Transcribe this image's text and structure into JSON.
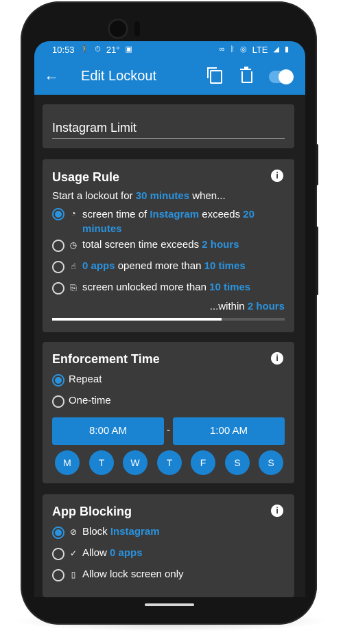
{
  "status": {
    "time": "10:53",
    "temp": "21°",
    "network": "LTE"
  },
  "appbar": {
    "back": "←",
    "title": "Edit Lockout"
  },
  "name_field": {
    "value": "Instagram Limit"
  },
  "usage_rule": {
    "title": "Usage Rule",
    "intro_prefix": "Start a lockout for ",
    "intro_value": "30 minutes",
    "intro_suffix": " when...",
    "options": [
      {
        "text1": "screen time of ",
        "value1": "Instagram",
        "text2": " exceeds ",
        "value2": "20 minutes",
        "selected": true,
        "icon": "pie-icon"
      },
      {
        "text1": "total screen time exceeds ",
        "value1": "2 hours",
        "selected": false,
        "icon": "clock-icon"
      },
      {
        "value1": "0 apps",
        "text1": " opened more than ",
        "value2": "10 times",
        "selected": false,
        "icon": "tap-icon"
      },
      {
        "text1": "screen unlocked more than ",
        "value1": "10 times",
        "selected": false,
        "icon": "unlock-icon"
      }
    ],
    "within_prefix": "...within ",
    "within_value": "2 hours",
    "progress": 0.73
  },
  "enforcement": {
    "title": "Enforcement Time",
    "options": [
      "Repeat",
      "One-time"
    ],
    "start": "8:00 AM",
    "dash": "-",
    "end": "1:00 AM",
    "days": [
      "M",
      "T",
      "W",
      "T",
      "F",
      "S",
      "S"
    ]
  },
  "app_blocking": {
    "title": "App Blocking",
    "options": [
      {
        "text": "Block ",
        "value": "Instagram",
        "selected": true,
        "icon": "block-icon"
      },
      {
        "text": "Allow ",
        "value": "0 apps",
        "selected": false,
        "icon": "check-circle-icon"
      },
      {
        "text": "Allow lock screen only",
        "selected": false,
        "icon": "phone-icon"
      }
    ]
  },
  "colors": {
    "accent": "#1a84d3",
    "highlight": "#2a93df",
    "card": "#3a3a3a",
    "background": "#1f1f1f"
  }
}
